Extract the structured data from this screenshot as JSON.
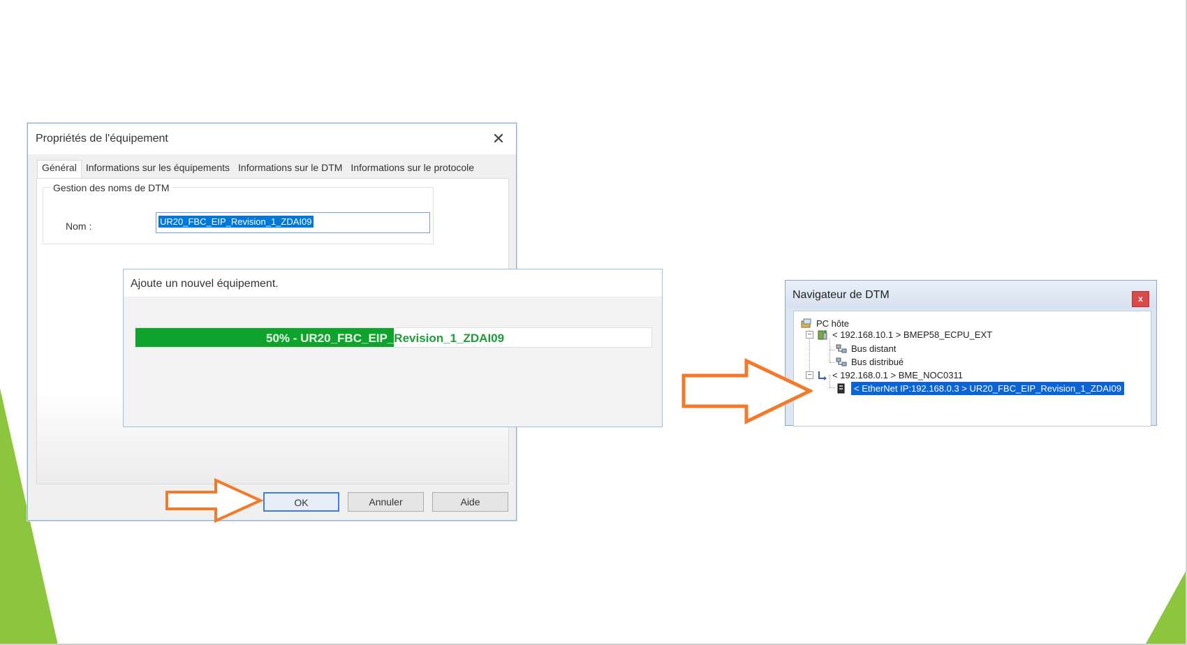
{
  "dialog": {
    "title": "Propriétés de l'équipement",
    "tabs": [
      "Général",
      "Informations sur les équipements",
      "Informations sur le DTM",
      "Informations sur le protocole"
    ],
    "group_label": "Gestion des noms de DTM",
    "name_label": "Nom :",
    "name_value": "UR20_FBC_EIP_Revision_1_ZDAI09",
    "buttons": {
      "ok": "OK",
      "cancel": "Annuler",
      "help": "Aide"
    }
  },
  "progress": {
    "title": "Ajoute un nouvel équipement.",
    "percent": 50,
    "text": "50% - UR20_FBC_EIP_Revision_1_ZDAI09"
  },
  "navigator": {
    "title": "Navigateur de DTM",
    "close_label": "x",
    "tree": [
      {
        "label": "PC hôte",
        "level": 0,
        "icon": "pc-icon"
      },
      {
        "label": "< 192.168.10.1 > BMEP58_ECPU_EXT",
        "level": 1,
        "icon": "cpu-icon",
        "expanded": true
      },
      {
        "label": "Bus distant",
        "level": 2,
        "icon": "bus-icon"
      },
      {
        "label": "Bus distribué",
        "level": 2,
        "icon": "bus-icon"
      },
      {
        "label": "< 192.168.0.1 > BME_NOC0311",
        "level": 1,
        "icon": "noc-icon",
        "expanded": true
      },
      {
        "label": "< EtherNet IP:192.168.0.3 > UR20_FBC_EIP_Revision_1_ZDAI09",
        "level": 2,
        "icon": "device-icon",
        "selected": true
      }
    ]
  },
  "colors": {
    "progress_green": "#0fa32e",
    "selection_blue": "#0a64d6",
    "arrow_orange": "#f37a2a",
    "deco_green": "#8cc63f"
  }
}
